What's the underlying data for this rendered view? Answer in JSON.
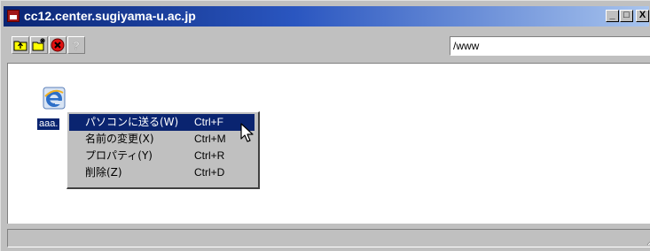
{
  "window": {
    "title": "cc12.center.sugiyama-u.ac.jp",
    "controls": {
      "minimize": "_",
      "maximize": "□",
      "close": "X"
    }
  },
  "toolbar": {
    "buttons": [
      "up-folder-icon",
      "new-folder-icon",
      "stop-icon",
      "help-icon"
    ],
    "path_value": "/www"
  },
  "file_list": {
    "items": [
      {
        "name": "aaa.",
        "icon": "internet-explorer-icon",
        "selected": true
      }
    ]
  },
  "context_menu": {
    "items": [
      {
        "label": "パソコンに送る(W)",
        "shortcut": "Ctrl+F",
        "highlighted": true
      },
      {
        "label": "名前の変更(X)",
        "shortcut": "Ctrl+M",
        "highlighted": false
      },
      {
        "label": "プロパティ(Y)",
        "shortcut": "Ctrl+R",
        "highlighted": false
      },
      {
        "label": "削除(Z)",
        "shortcut": "Ctrl+D",
        "highlighted": false
      }
    ]
  },
  "status_bar": {
    "text": ""
  },
  "colors": {
    "title_start": "#0a2573",
    "title_end": "#a8c4ee",
    "selection": "#0a2470",
    "face": "#c0c0c0"
  }
}
